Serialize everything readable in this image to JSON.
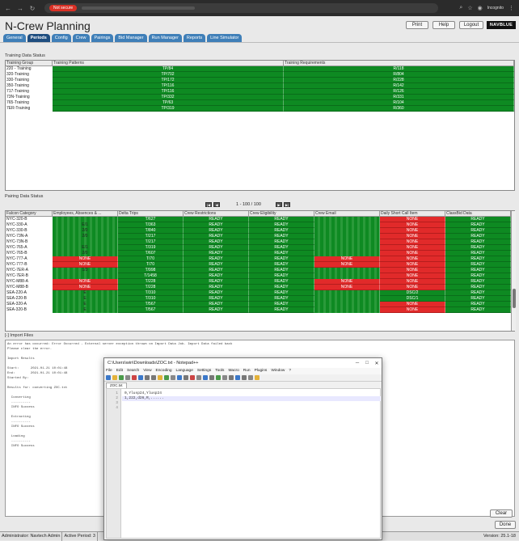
{
  "browser": {
    "security_label": "Not secure",
    "profile_label": "Incognito"
  },
  "app": {
    "title": "N-Crew Planning",
    "buttons": {
      "print": "Print",
      "help": "Help",
      "logout": "Logout"
    },
    "logo_text": "NAVBLUE",
    "tabs": [
      "General",
      "Periods",
      "Config",
      "Crew",
      "Pairings",
      "Bid Manager",
      "Run Manager",
      "Reports",
      "Line Simulator"
    ],
    "active_tab": "Periods"
  },
  "training": {
    "section_title": "Training Data Status",
    "headers": [
      "Training Group",
      "Training Patterns",
      "Training Requirements"
    ],
    "rows": [
      [
        "220 - Training",
        "TP/84",
        "R/118"
      ],
      [
        "320-Training",
        "TP/702",
        "R/804"
      ],
      [
        "330-Training",
        "TP/172",
        "R/228"
      ],
      [
        "350-Training",
        "TP/116",
        "R/142"
      ],
      [
        "717-Training",
        "TP/116",
        "R/126"
      ],
      [
        "73N-Training",
        "TP/332",
        "R/331"
      ],
      [
        "765-Training",
        "TP/63",
        "R/104"
      ],
      [
        "7ER-Training",
        "TP/319",
        "R/360"
      ]
    ]
  },
  "pairing": {
    "section_title": "Pairing Data Status",
    "pager_text": "1 - 100 / 100",
    "headers": [
      "Falcon Category",
      "Employees, Absences & ...",
      "Delta Trips",
      "Crew Restrictions",
      "Crew Eligibility",
      "Crew Email",
      "Daily Short Call Item",
      "ClassBid Data"
    ],
    "rows": [
      {
        "cat": "NYC-320-B",
        "emp": "",
        "trips": "T/627",
        "restr": "READY",
        "elig": "READY",
        "email": "",
        "short": "NONE",
        "cb": "READY",
        "emp_red": false,
        "email_red": false,
        "short_red": true,
        "cb_red": false
      },
      {
        "cat": "NYC-330-A",
        "emp": "E/1",
        "trips": "T/363",
        "restr": "READY",
        "elig": "READY",
        "email": "",
        "short": "NONE",
        "cb": "READY",
        "emp_red": false,
        "email_red": false,
        "short_red": true,
        "cb_red": false
      },
      {
        "cat": "NYC-330-B",
        "emp": "2/0",
        "trips": "T/840",
        "restr": "READY",
        "elig": "READY",
        "email": "",
        "short": "NONE",
        "cb": "READY",
        "emp_red": false,
        "email_red": false,
        "short_red": true,
        "cb_red": false
      },
      {
        "cat": "NYC-73N-A",
        "emp": "2/0",
        "trips": "T/217",
        "restr": "READY",
        "elig": "READY",
        "email": "",
        "short": "NONE",
        "cb": "READY",
        "emp_red": false,
        "email_red": false,
        "short_red": true,
        "cb_red": false
      },
      {
        "cat": "NYC-73N-B",
        "emp": "",
        "trips": "T/217",
        "restr": "READY",
        "elig": "READY",
        "email": "",
        "short": "NONE",
        "cb": "READY",
        "emp_red": false,
        "email_red": false,
        "short_red": true,
        "cb_red": false
      },
      {
        "cat": "NYC-765-A",
        "emp": "E/1",
        "trips": "T/319",
        "restr": "READY",
        "elig": "READY",
        "email": "",
        "short": "NONE",
        "cb": "READY",
        "emp_red": false,
        "email_red": false,
        "short_red": true,
        "cb_red": false
      },
      {
        "cat": "NYC-765-B",
        "emp": "2/0",
        "trips": "T/607",
        "restr": "READY",
        "elig": "READY",
        "email": "",
        "short": "NONE",
        "cb": "READY",
        "emp_red": false,
        "email_red": false,
        "short_red": true,
        "cb_red": false
      },
      {
        "cat": "NYC-777-A",
        "emp": "NONE",
        "trips": "T/70",
        "restr": "READY",
        "elig": "READY",
        "email": "NONE",
        "short": "NONE",
        "cb": "READY",
        "emp_red": true,
        "email_red": true,
        "short_red": true,
        "cb_red": false
      },
      {
        "cat": "NYC-777-B",
        "emp": "NONE",
        "trips": "T/70",
        "restr": "READY",
        "elig": "READY",
        "email": "NONE",
        "short": "NONE",
        "cb": "READY",
        "emp_red": true,
        "email_red": true,
        "short_red": true,
        "cb_red": false
      },
      {
        "cat": "NYC-7ER-A",
        "emp": "1/3",
        "trips": "T/998",
        "restr": "READY",
        "elig": "READY",
        "email": "",
        "short": "NONE",
        "cb": "READY",
        "emp_red": false,
        "email_red": false,
        "short_red": true,
        "cb_red": false
      },
      {
        "cat": "NYC-7ER-B",
        "emp": "",
        "trips": "T/1458",
        "restr": "READY",
        "elig": "READY",
        "email": "",
        "short": "NONE",
        "cb": "READY",
        "emp_red": false,
        "email_red": false,
        "short_red": true,
        "cb_red": false
      },
      {
        "cat": "NYC-M88-A",
        "emp": "NONE",
        "trips": "T/228",
        "restr": "READY",
        "elig": "READY",
        "email": "NONE",
        "short": "NONE",
        "cb": "READY",
        "emp_red": true,
        "email_red": true,
        "short_red": true,
        "cb_red": false
      },
      {
        "cat": "NYC-M88-B",
        "emp": "NONE",
        "trips": "T/228",
        "restr": "READY",
        "elig": "READY",
        "email": "NONE",
        "short": "NONE",
        "cb": "READY",
        "emp_red": true,
        "email_red": true,
        "short_red": true,
        "cb_red": false
      },
      {
        "cat": "SEA-220-A",
        "emp": "E",
        "trips": "T/310",
        "restr": "READY",
        "elig": "READY",
        "email": "",
        "short": "DSC/2",
        "cb": "READY",
        "emp_red": false,
        "email_red": false,
        "short_red": false,
        "cb_red": false
      },
      {
        "cat": "SEA-220-B",
        "emp": "E",
        "trips": "T/310",
        "restr": "READY",
        "elig": "READY",
        "email": "",
        "short": "DSC/1",
        "cb": "READY",
        "emp_red": false,
        "email_red": false,
        "short_red": false,
        "cb_red": false
      },
      {
        "cat": "SEA-320-A",
        "emp": "E",
        "trips": "T/567",
        "restr": "READY",
        "elig": "READY",
        "email": "",
        "short": "NONE",
        "cb": "READY",
        "emp_red": false,
        "email_red": false,
        "short_red": true,
        "cb_red": false
      },
      {
        "cat": "SEA-320-B",
        "emp": "E",
        "trips": "T/567",
        "restr": "READY",
        "elig": "READY",
        "email": "",
        "short": "NONE",
        "cb": "READY",
        "emp_red": false,
        "email_red": false,
        "short_red": true,
        "cb_red": false
      }
    ]
  },
  "import": {
    "section_title": "[-] Import Files",
    "log_lines": [
      "An error has occurred: Error Occurred - External server exception thrown on Import Data Job. Import Data failed back",
      "Please clear the error.",
      "",
      "Import Results",
      "",
      "Start:      2021.01.21 10:01:48",
      "End:        2021.01.21 10:01:48",
      "Started By:",
      "",
      "Results for: converting ZOC.txt",
      "",
      "  Converting",
      "  ----------",
      "  INFO Success",
      "",
      "  Extracting",
      "  ----------",
      "  INFO Success",
      "",
      "  Loading",
      "  ----------",
      "  INFO Success"
    ],
    "clear_label": "Clear",
    "done_label": "Done"
  },
  "statusbar": {
    "user": "Administrator: Navtech Admin",
    "period": "Active Period: 3",
    "version": "Version: 25.1-18"
  },
  "notepad": {
    "title": "C:\\Users\\win\\Downloads\\ZOC.txt - Notepad++",
    "menu": [
      "File",
      "Edit",
      "Search",
      "View",
      "Encoding",
      "Language",
      "Settings",
      "Tools",
      "Macro",
      "Run",
      "Plugins",
      "Window",
      "?"
    ],
    "tab_label": "ZOC.txt",
    "lines": [
      "0,Ylusp24,Ylusp24",
      "1,222,d26,R,......",
      "",
      ""
    ],
    "close_glyph": "✕",
    "min_glyph": "─",
    "max_glyph": "□"
  }
}
